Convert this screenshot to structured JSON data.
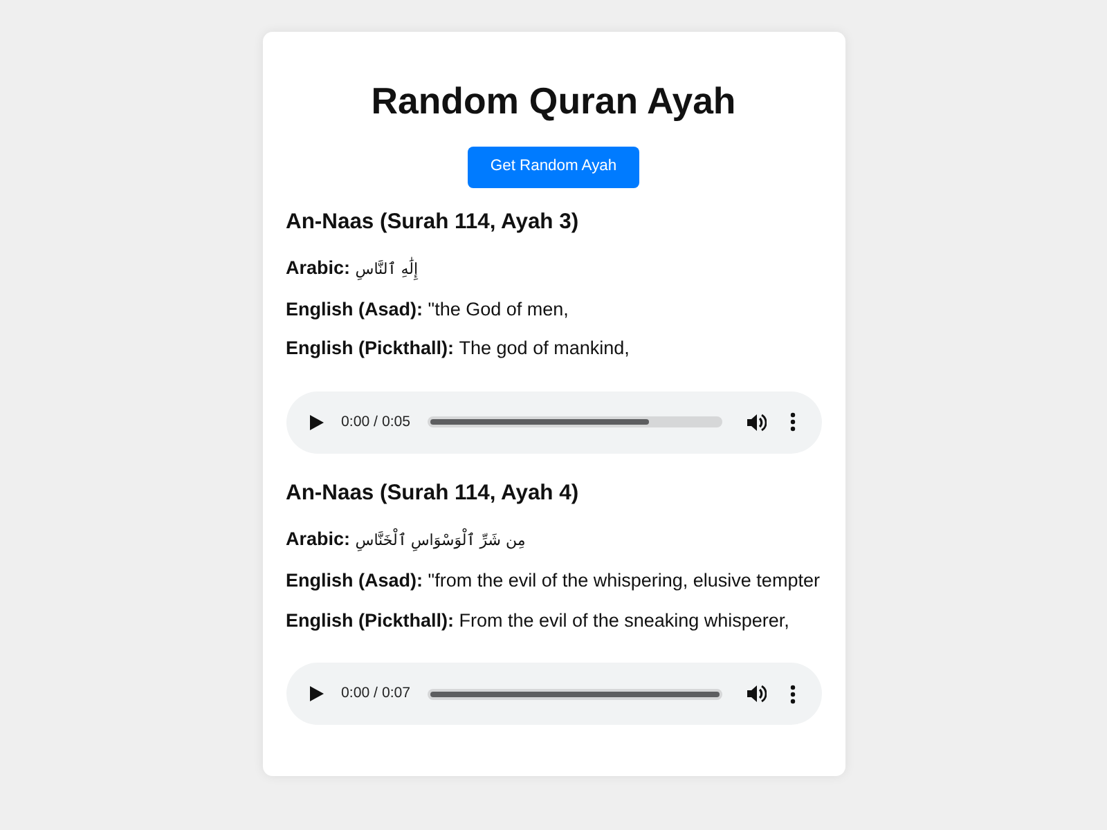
{
  "title": "Random Quran Ayah",
  "button": {
    "label": "Get Random Ayah"
  },
  "ayahs": [
    {
      "heading": "An-Naas (Surah 114, Ayah 3)",
      "lines": [
        {
          "kind": "arabic",
          "label": "Arabic:",
          "text": "إِلَٰهِ ٱلنَّاسِ"
        },
        {
          "kind": "translation",
          "label": "English (Asad):",
          "text": "\"the God of men,"
        },
        {
          "kind": "translation",
          "label": "English (Pickthall):",
          "text": "The god of mankind,"
        }
      ],
      "audio": {
        "time": "0:00 / 0:05",
        "level": 0.76
      }
    },
    {
      "heading": "An-Naas (Surah 114, Ayah 4)",
      "lines": [
        {
          "kind": "arabic",
          "label": "Arabic:",
          "text": "مِن شَرِّ ٱلْوَسْوَاسِ ٱلْخَنَّاسِ"
        },
        {
          "kind": "translation",
          "label": "English (Asad):",
          "text": "\"from the evil of the whispering, elusive tempter"
        },
        {
          "kind": "translation",
          "label": "English (Pickthall):",
          "text": "From the evil of the sneaking whisperer,"
        }
      ],
      "audio": {
        "time": "0:00 / 0:07",
        "level": 1
      }
    }
  ]
}
